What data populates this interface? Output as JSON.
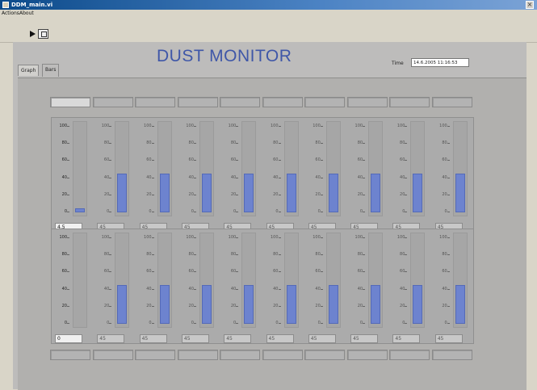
{
  "window": {
    "title": "DDM_main.vi"
  },
  "menu": {
    "items": [
      "Actions",
      "About"
    ]
  },
  "app_title": "DUST MONITOR",
  "tabs": [
    {
      "label": "Graph"
    },
    {
      "label": "Bars"
    }
  ],
  "time": {
    "label": "Time",
    "value": "14.6.2005 11:16:53"
  },
  "scale_labels": [
    "100",
    "80",
    "60",
    "40",
    "20",
    "0"
  ],
  "top_leds": [
    true,
    false,
    false,
    false,
    false,
    false,
    false,
    false,
    false,
    false
  ],
  "bottom_leds": [
    false,
    false,
    false,
    false,
    false,
    false,
    false,
    false,
    false,
    false
  ],
  "row1": {
    "values": [
      4.5,
      45,
      45,
      45,
      45,
      45,
      45,
      45,
      45,
      45
    ],
    "display": [
      "4.5",
      "45",
      "45",
      "45",
      "45",
      "45",
      "45",
      "45",
      "45",
      "45"
    ]
  },
  "row2": {
    "values": [
      0,
      45,
      45,
      45,
      45,
      45,
      45,
      45,
      45,
      45
    ],
    "display": [
      "0",
      "45",
      "45",
      "45",
      "45",
      "45",
      "45",
      "45",
      "45",
      "45"
    ]
  },
  "colors": {
    "bar_fill": "#6d83cf",
    "title": "#3f57a8"
  }
}
